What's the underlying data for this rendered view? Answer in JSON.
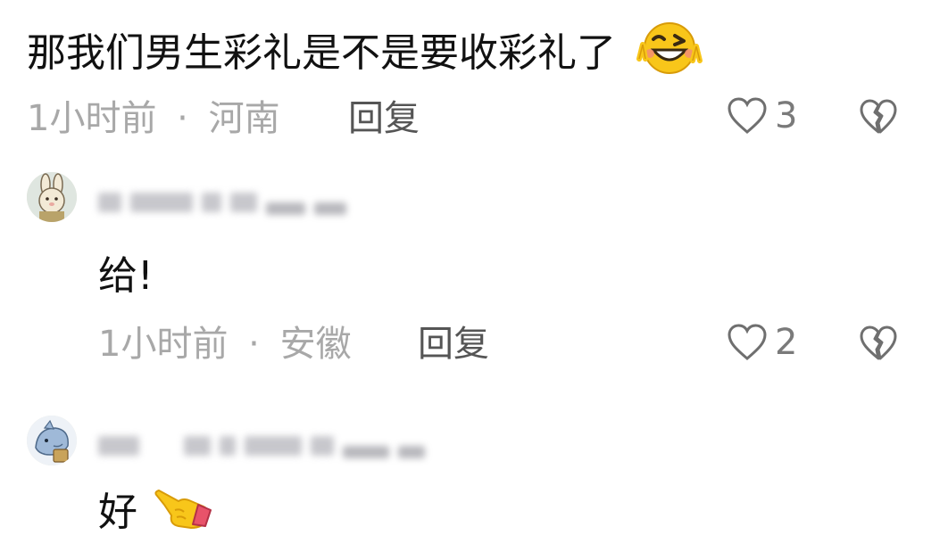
{
  "comments": [
    {
      "text": "那我们男生彩礼是不是要收彩礼了",
      "emoji": "grinning-wink-peace-emoji",
      "time": "1小时前",
      "sep": "·",
      "location": "河南",
      "reply_label": "回复",
      "likes": "3",
      "icons": [
        "heart-outline-icon",
        "broken-heart-icon"
      ]
    },
    {
      "avatar": "bunny-avatar",
      "text": "给!",
      "time": "1小时前",
      "sep": "·",
      "location": "安徽",
      "reply_label": "回复",
      "likes": "2",
      "icons": [
        "heart-outline-icon",
        "broken-heart-icon"
      ]
    },
    {
      "avatar": "dolphin-avatar",
      "text": "好",
      "emoji": "pointing-hand-emoji"
    }
  ],
  "colors": {
    "text": "#111111",
    "meta": "#a8a8a8",
    "reply": "#555555",
    "icon": "#6f6f6f"
  }
}
